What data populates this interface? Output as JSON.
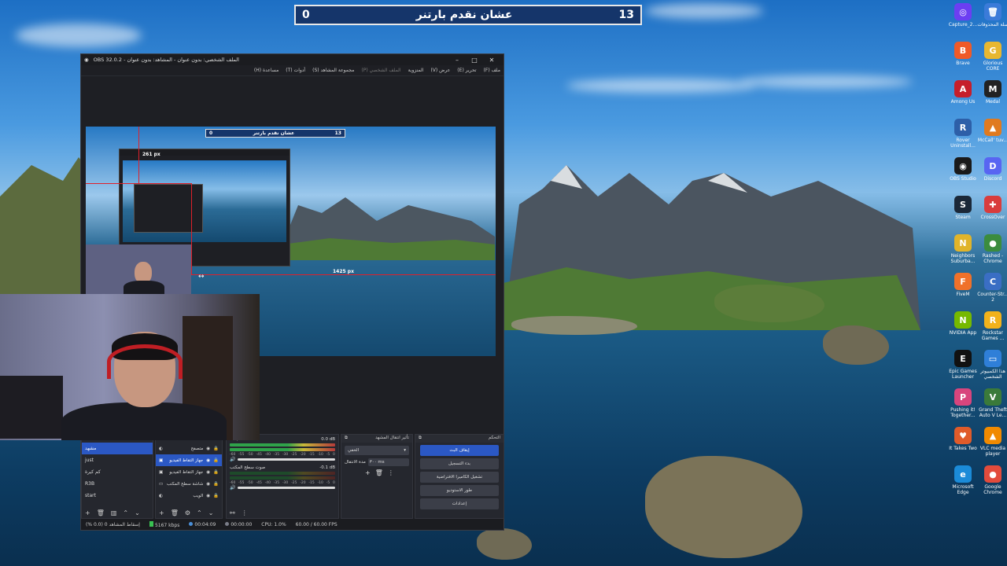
{
  "scorebar": {
    "left_score": "13",
    "title": "عشان نقدم بارتنر",
    "right_score": "0"
  },
  "obs": {
    "title": "OBS 32.0.2 - الملف الشخصي: بدون عنوان - المشاهد: بدون عنوان",
    "menu": [
      "ملف (F)",
      "تحرير (E)",
      "عرض (V)",
      "المنزوية",
      "الملف الشخصي (P)",
      "مجموعة المشاهد (S)",
      "أدوات (T)",
      "مساعدة (H)"
    ],
    "preview": {
      "score_left": "0",
      "score_title": "عشان نقدم بارتنر",
      "score_right": "13",
      "dim_vertical": "261 px",
      "dim_horizontal": "1425 px"
    },
    "scenes": {
      "items": [
        "مشهد",
        "just",
        "كم كيرة",
        "R3B",
        "start"
      ]
    },
    "sources": {
      "items": [
        "متصفح",
        "جهاز التقاط الفيديو",
        "جهاز التقاط الفيديو",
        "شاشة سطح المكتب",
        "الويب"
      ]
    },
    "mixer": {
      "channels": [
        {
          "name": "Mic/Aux",
          "db": "0.0 dB"
        },
        {
          "name": "صوت سطح المكتب",
          "db": "-0.1 dB"
        }
      ],
      "scale": [
        "-60",
        "-55",
        "-50",
        "-45",
        "-40",
        "-35",
        "-30",
        "-25",
        "-20",
        "-15",
        "-10",
        "-5",
        "0"
      ]
    },
    "transitions": {
      "title": "تأثير انتقال المشهد",
      "selected": "الخفي",
      "duration_label": "مدة الانتقال",
      "duration_value": "٣٠٠ ms"
    },
    "controls": {
      "title": "التحكم",
      "buttons": [
        "إيقاف البث",
        "بدء التسجيل",
        "تشغيل الكاميرا الافتراضية",
        "طور الاستوديو",
        "إعدادات"
      ]
    },
    "status": {
      "dropped": "إسقاط المشاهد 0 (0.0 %)",
      "bitrate": "5167 kbps",
      "stream_time": "00:04:09",
      "rec_time": "00:00:00",
      "cpu": "CPU: 1.0%",
      "fps": "60.00 / 60.00 FPS"
    }
  },
  "desktop_icons": [
    {
      "label": "Capture_2...",
      "color": "#6c3ef2",
      "glyph": "◎"
    },
    {
      "label": "سلة المحذوفات",
      "color": "#3b7bd9",
      "glyph": "🗑"
    },
    {
      "label": "Brave",
      "color": "#f05a28",
      "glyph": "B"
    },
    {
      "label": "Glorious CORE",
      "color": "#e8b730",
      "glyph": "G"
    },
    {
      "label": "Among Us",
      "color": "#c61e2b",
      "glyph": "A"
    },
    {
      "label": "Medal",
      "color": "#222",
      "glyph": "M"
    },
    {
      "label": "Rover Uninstall...",
      "color": "#2d5fa8",
      "glyph": "R"
    },
    {
      "label": "McCall' tuv...",
      "color": "#e07a1f",
      "glyph": "▲"
    },
    {
      "label": "OBS Studio",
      "color": "#1a1a1a",
      "glyph": "◉"
    },
    {
      "label": "Discord",
      "color": "#5865f2",
      "glyph": "D"
    },
    {
      "label": "Steam",
      "color": "#1b2838",
      "glyph": "S"
    },
    {
      "label": "CrossOver",
      "color": "#d93c3c",
      "glyph": "✚"
    },
    {
      "label": "Neighbors Suburba...",
      "color": "#e0b42a",
      "glyph": "N"
    },
    {
      "label": "Rashed - Chrome",
      "color": "#3b8c3e",
      "glyph": "●"
    },
    {
      "label": "FiveM",
      "color": "#f0712a",
      "glyph": "F"
    },
    {
      "label": "Counter-Str... 2",
      "color": "#3a6ec4",
      "glyph": "C"
    },
    {
      "label": "NVIDIA App",
      "color": "#76b900",
      "glyph": "N"
    },
    {
      "label": "Rockstar Games ...",
      "color": "#f2b21b",
      "glyph": "R"
    },
    {
      "label": "Epic Games Launcher",
      "color": "#111",
      "glyph": "E"
    },
    {
      "label": "هذا الكمبيوتر الشخصي",
      "color": "#2f7fd8",
      "glyph": "▭"
    },
    {
      "label": "Pushing it! Together...",
      "color": "#d8457d",
      "glyph": "P"
    },
    {
      "label": "Grand Theft Auto V Le...",
      "color": "#3a7a3a",
      "glyph": "V"
    },
    {
      "label": "It Takes Two",
      "color": "#e05b2a",
      "glyph": "♥"
    },
    {
      "label": "VLC media player",
      "color": "#f08a00",
      "glyph": "▲"
    },
    {
      "label": "Microsoft Edge",
      "color": "#1b8bd8",
      "glyph": "e"
    },
    {
      "label": "Google Chrome",
      "color": "#e24b3c",
      "glyph": "●"
    }
  ]
}
